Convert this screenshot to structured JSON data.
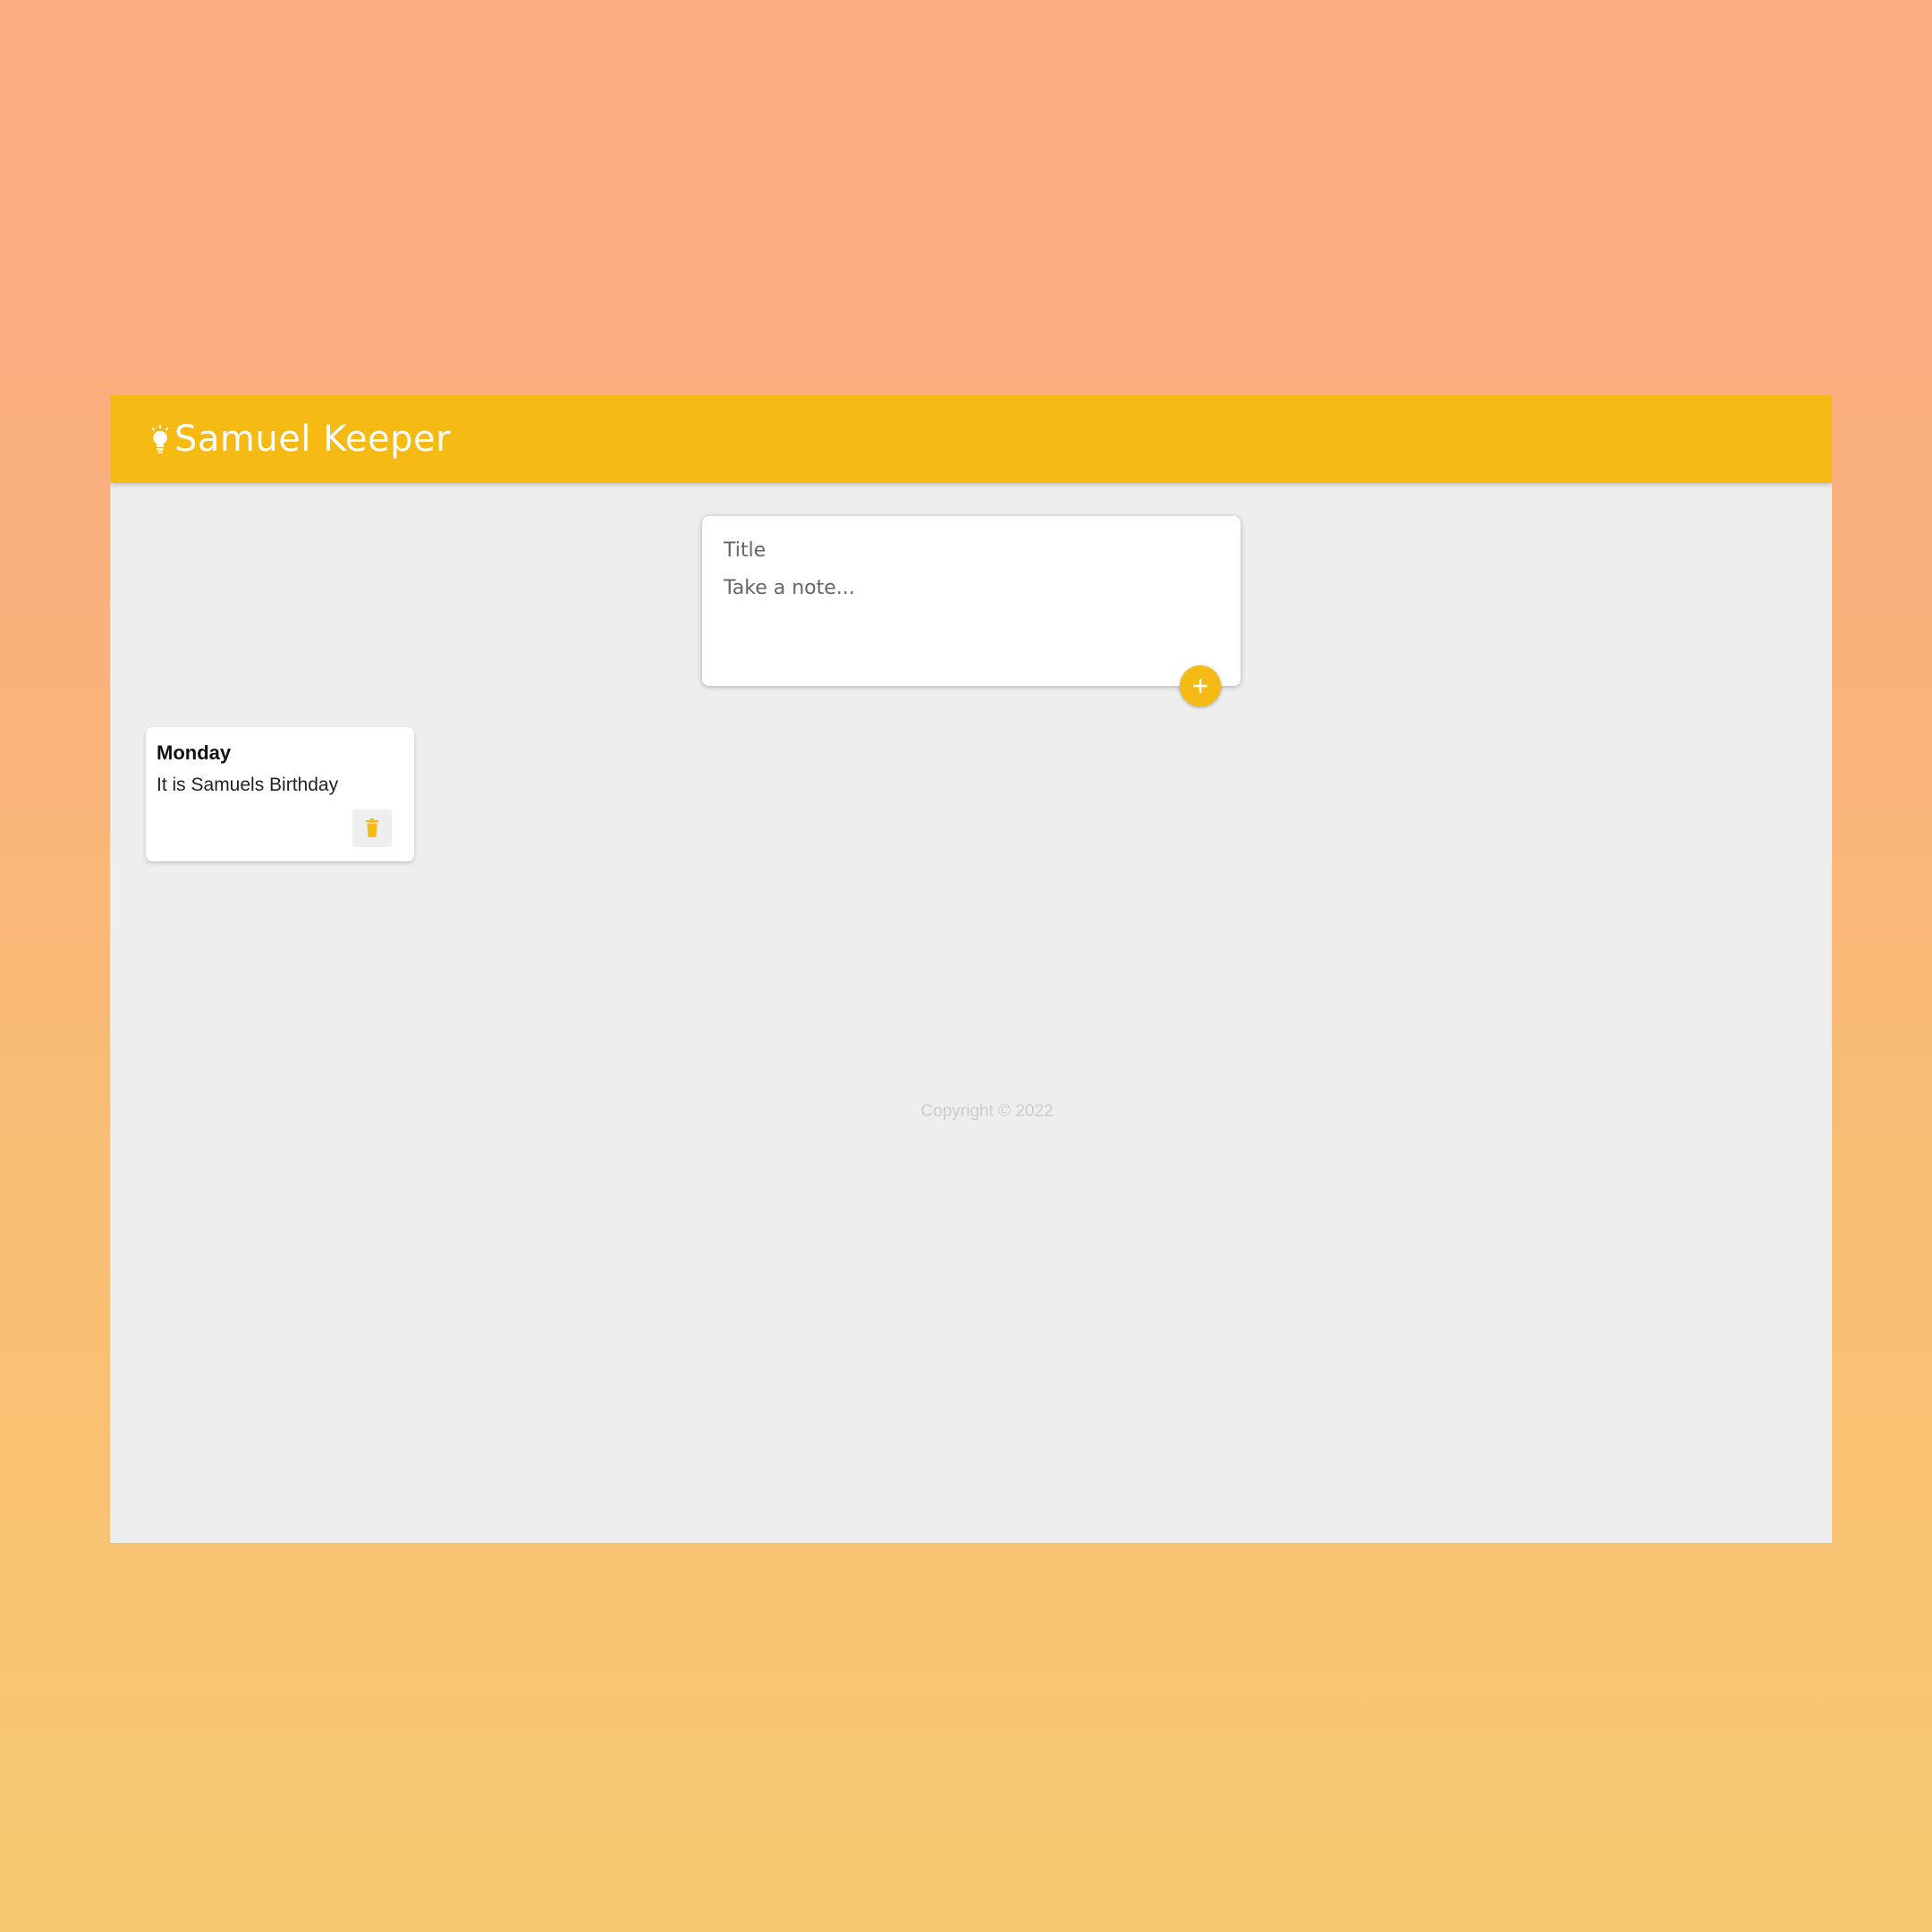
{
  "header": {
    "title": "Samuel Keeper",
    "icon": "lightbulb-icon",
    "background_color": "#F5BA13"
  },
  "compose": {
    "title_placeholder": "Title",
    "content_placeholder": "Take a note...",
    "add_icon": "plus-icon"
  },
  "notes": [
    {
      "title": "Monday",
      "content": "It is Samuels Birthday",
      "delete_icon": "trash-icon"
    }
  ],
  "footer": {
    "text": "Copyright © 2022"
  },
  "colors": {
    "accent": "#F5BA13",
    "app_background": "#EEEEEE",
    "card_background": "#FFFFFF"
  }
}
